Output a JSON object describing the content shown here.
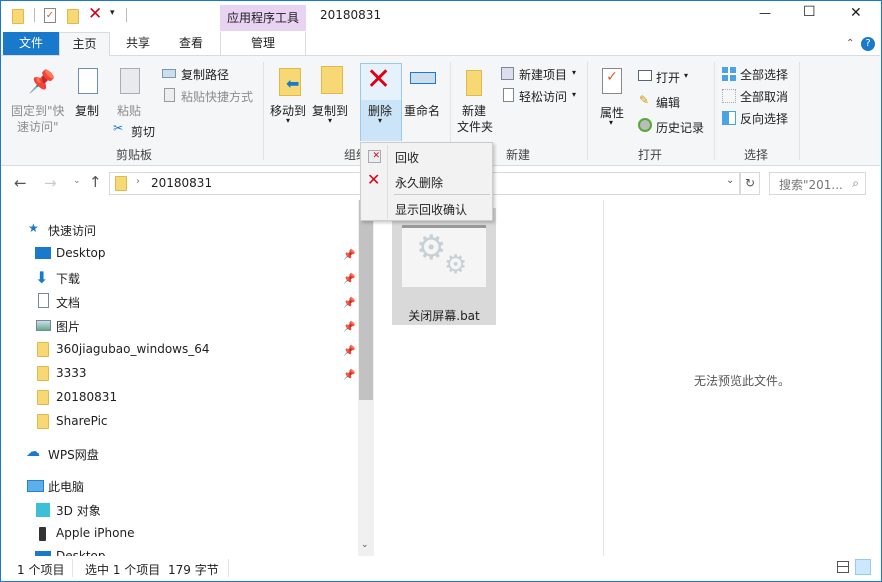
{
  "title_bar": {
    "context_tab": "应用程序工具",
    "title": "20180831",
    "minimize": "—",
    "maximize": "☐",
    "close": "✕"
  },
  "tabs": [
    {
      "label": "文件"
    },
    {
      "label": "主页"
    },
    {
      "label": "共享"
    },
    {
      "label": "查看"
    },
    {
      "label": "管理"
    }
  ],
  "ribbon": {
    "clipboard": {
      "pin": "固定到\"快",
      "pin2": "速访问\"",
      "copy": "复制",
      "paste": "粘贴",
      "copy_path": "复制路径",
      "paste_shortcut": "粘贴快捷方式",
      "cut": "剪切",
      "group": "剪贴板"
    },
    "organize": {
      "move_to": "移动到",
      "copy_to": "复制到",
      "delete": "删除",
      "rename": "重命名",
      "group": "组织"
    },
    "new": {
      "new_folder": "新建",
      "new_folder2": "文件夹",
      "new_item": "新建项目",
      "easy_access": "轻松访问",
      "group": "新建"
    },
    "open": {
      "properties": "属性",
      "open": "打开",
      "edit": "编辑",
      "history": "历史记录",
      "group": "打开"
    },
    "select": {
      "select_all": "全部选择",
      "select_none": "全部取消",
      "invert": "反向选择",
      "group": "选择"
    }
  },
  "delete_menu": {
    "items": [
      {
        "label": "回收"
      },
      {
        "label": "永久删除"
      },
      {
        "label": "显示回收确认"
      }
    ]
  },
  "address": {
    "path": "20180831",
    "search_placeholder": "搜索\"201... "
  },
  "nav_pane": {
    "quick_access": "快速访问",
    "items": [
      {
        "label": "Desktop"
      },
      {
        "label": "下载"
      },
      {
        "label": "文档"
      },
      {
        "label": "图片"
      },
      {
        "label": "360jiagubao_windows_64"
      },
      {
        "label": "3333"
      },
      {
        "label": "20180831"
      },
      {
        "label": "SharePic"
      }
    ],
    "wps": "WPS网盘",
    "this_pc": "此电脑",
    "pc_items": [
      {
        "label": "3D 对象"
      },
      {
        "label": "Apple iPhone"
      },
      {
        "label": "Desktop"
      }
    ]
  },
  "files": [
    {
      "name": "关闭屏幕.bat"
    }
  ],
  "preview": {
    "text": "无法预览此文件。"
  },
  "status": {
    "count": "1 个项目",
    "selected": "选中 1 个项目",
    "size": "179 字节"
  },
  "colors": {
    "accent": "#1979ca",
    "context": "#e9d3f3",
    "selected": "#cce8ff"
  }
}
